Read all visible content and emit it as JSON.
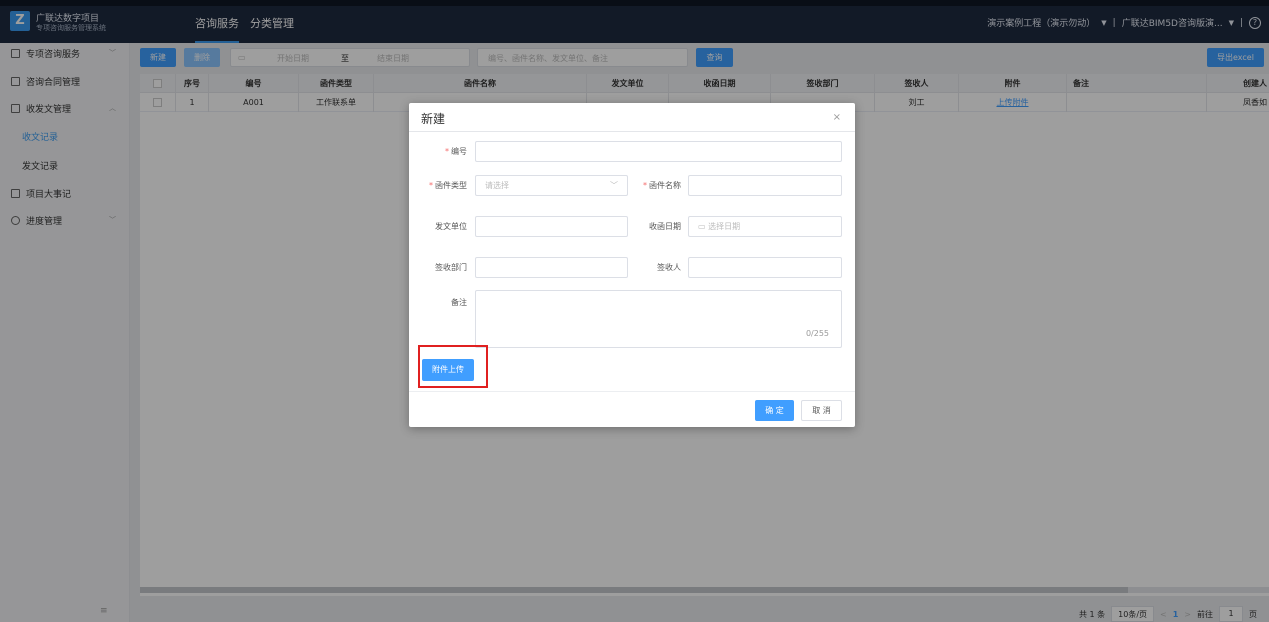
{
  "header": {
    "brand_title": "广联达数字项目",
    "brand_subtitle": "专项咨询服务管理系统",
    "logo_glyph": "Z",
    "nav": [
      {
        "label": "咨询服务",
        "active": true
      },
      {
        "label": "分类管理",
        "active": false
      }
    ],
    "project_select": "演示案例工程（演示勿动）",
    "org_select": "广联达BIM5D咨询版演...",
    "separator": "|",
    "dropdown_arrow": "▼",
    "help_glyph": "?"
  },
  "sidebar": {
    "items": [
      {
        "label": "专项咨询服务",
        "icon": "list-icon",
        "chevron": "﹀"
      },
      {
        "label": "咨询合同管理",
        "icon": "contract-icon",
        "chevron": ""
      },
      {
        "label": "收发文管理",
        "icon": "document-icon",
        "chevron": "︿"
      },
      {
        "label": "项目大事记",
        "icon": "calendar-icon",
        "chevron": ""
      },
      {
        "label": "进度管理",
        "icon": "clock-icon",
        "chevron": "﹀"
      }
    ],
    "sub_items": [
      {
        "label": "收文记录",
        "active": true
      },
      {
        "label": "发文记录",
        "active": false
      }
    ],
    "collapse_glyph": "≡"
  },
  "toolbar": {
    "new_label": "新建",
    "delete_label": "删除",
    "date_start_placeholder": "开始日期",
    "date_sep": "至",
    "date_end_placeholder": "结束日期",
    "search_placeholder": "编号、函件名称、发文单位、备注",
    "query_label": "查询",
    "export_label": "导出excel"
  },
  "table": {
    "columns": [
      "序号",
      "编号",
      "函件类型",
      "函件名称",
      "发文单位",
      "收函日期",
      "签收部门",
      "签收人",
      "附件",
      "备注",
      "创建人"
    ],
    "rows": [
      {
        "index": "1",
        "code": "A001",
        "type": "工作联系单",
        "name": "",
        "sender": "",
        "date": "",
        "dept": "",
        "receiver": "刘工",
        "attachment": "上传附件",
        "remark": "",
        "creator": "凤香如"
      }
    ]
  },
  "pager": {
    "total": "共 1 条",
    "page_size": "10条/页",
    "prev": "<",
    "current": "1",
    "next": ">",
    "goto_label": "前往",
    "goto_value": "1",
    "page_suffix": "页"
  },
  "dialog": {
    "title": "新建",
    "close_glyph": "×",
    "fields": {
      "code_label": "编号",
      "type_label": "函件类型",
      "type_placeholder": "请选择",
      "name_label": "函件名称",
      "sender_label": "发文单位",
      "date_label": "收函日期",
      "date_placeholder": "选择日期",
      "dept_label": "签收部门",
      "receiver_label": "签收人",
      "remark_label": "备注",
      "remark_counter": "0/255"
    },
    "required_mark": "*",
    "upload_label": "附件上传",
    "ok_label": "确 定",
    "cancel_label": "取 消"
  },
  "colors": {
    "primary": "#409eff",
    "header_bg": "#1e2a3f",
    "highlight_border": "#e02020",
    "required": "#f56c6c"
  }
}
